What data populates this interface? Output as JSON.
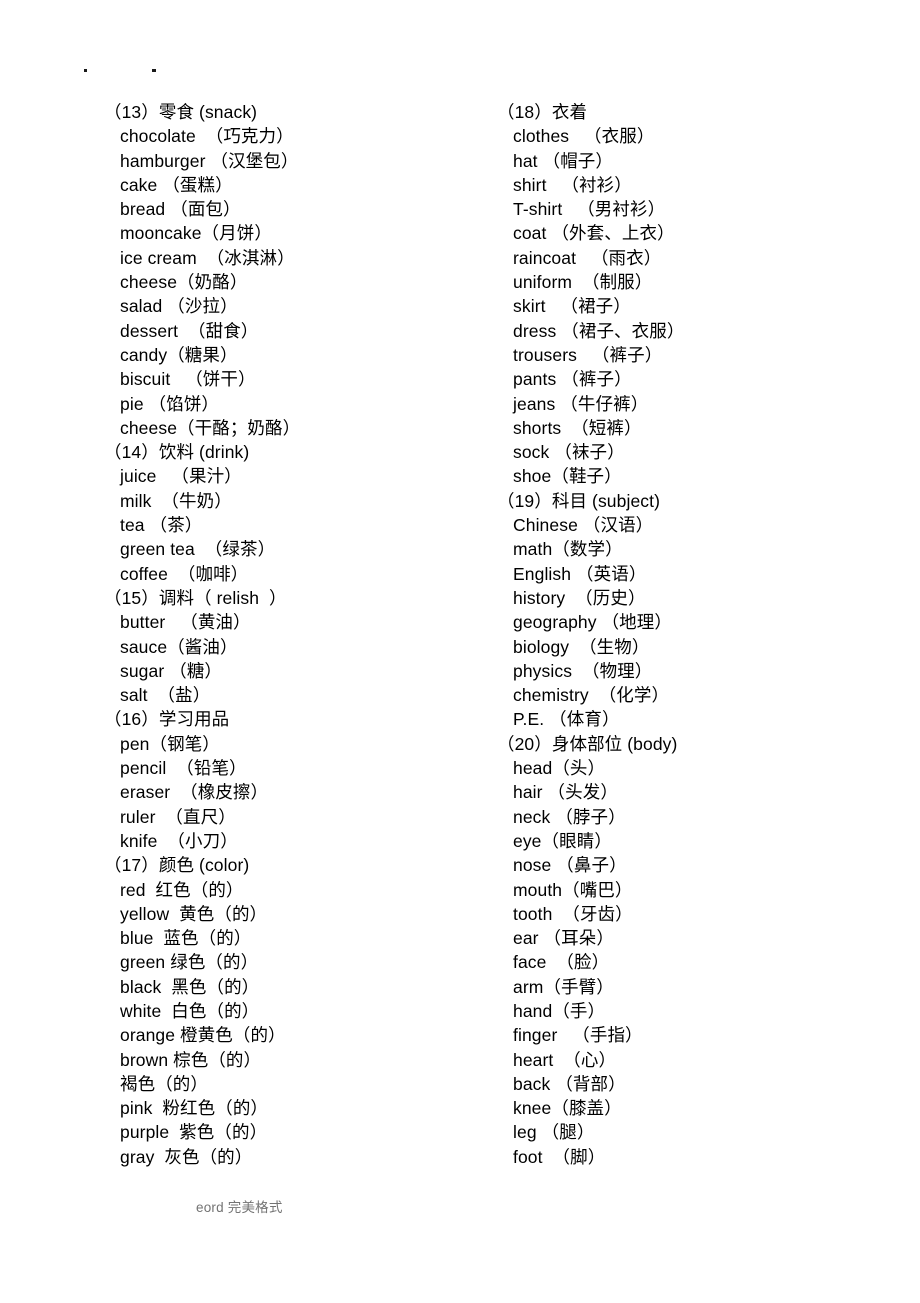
{
  "document": {
    "footer_text": "eord 完美格式"
  },
  "columns": {
    "left": {
      "sections": [
        {
          "heading": "（13）零食 (snack)",
          "entries": [
            "chocolate  （巧克力）",
            "hamburger （汉堡包）",
            "cake （蛋糕）",
            "bread （面包）",
            "mooncake（月饼）",
            "ice cream  （冰淇淋）",
            "cheese（奶酪）",
            "salad （沙拉）",
            "dessert  （甜食）",
            "candy（糖果）",
            "biscuit   （饼干）",
            "pie （馅饼）",
            "cheese（干酪；奶酪）"
          ]
        },
        {
          "heading": "（14）饮料 (drink)",
          "entries": [
            "juice   （果汁）",
            "milk  （牛奶）",
            "tea （茶）",
            "green tea  （绿茶）",
            "coffee  （咖啡）"
          ]
        },
        {
          "heading": "（15）调料（ relish  ）",
          "entries": [
            "butter   （黄油）",
            "sauce（酱油）",
            "sugar （糖）",
            "salt  （盐）"
          ]
        },
        {
          "heading": "（16）学习用品",
          "entries": [
            "pen（钢笔）",
            "pencil  （铅笔）",
            "eraser  （橡皮擦）",
            "ruler  （直尺）",
            "knife  （小刀）"
          ]
        },
        {
          "heading": "（17）颜色 (color)",
          "entries": [
            "red  红色（的）",
            "yellow  黄色（的）",
            "blue  蓝色（的）",
            "green 绿色（的）",
            "black  黑色（的）",
            "white  白色（的）",
            "orange 橙黄色（的）",
            "brown 棕色（的）",
            "褐色（的）",
            "pink  粉红色（的）",
            "purple  紫色（的）",
            "gray  灰色（的）"
          ]
        }
      ]
    },
    "right": {
      "sections": [
        {
          "heading": "（18）衣着",
          "entries": [
            "clothes   （衣服）",
            "hat （帽子）",
            "shirt   （衬衫）",
            "T-shirt   （男衬衫）",
            "coat （外套、上衣）",
            "raincoat   （雨衣）",
            "uniform  （制服）",
            "skirt   （裙子）",
            "dress （裙子、衣服）",
            "trousers   （裤子）",
            "pants （裤子）",
            "jeans （牛仔裤）",
            "shorts  （短裤）",
            "sock （袜子）",
            "shoe（鞋子）"
          ]
        },
        {
          "heading": "（19）科目 (subject)",
          "entries": [
            "Chinese （汉语）",
            "math（数学）",
            "English （英语）",
            "history  （历史）",
            "geography （地理）",
            "biology  （生物）",
            "physics  （物理）",
            "chemistry  （化学）",
            "P.E. （体育）"
          ]
        },
        {
          "heading": "（20）身体部位 (body)",
          "entries": [
            "head（头）",
            "hair （头发）",
            "neck （脖子）",
            "eye（眼睛）",
            "nose （鼻子）",
            "mouth（嘴巴）",
            "tooth  （牙齿）",
            "ear （耳朵）",
            "face  （脸）",
            "arm（手臂）",
            "hand（手）",
            "finger   （手指）",
            "heart  （心）",
            "back （背部）",
            "knee（膝盖）",
            "leg （腿）",
            "foot  （脚）"
          ]
        }
      ]
    }
  }
}
